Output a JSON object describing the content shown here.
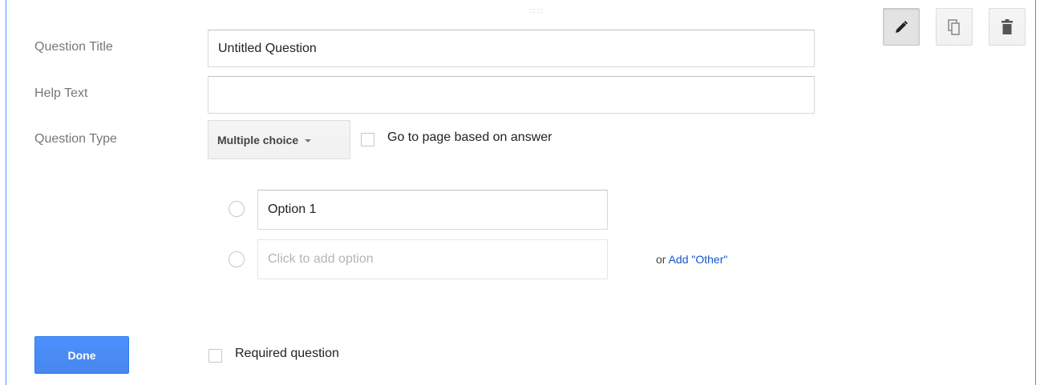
{
  "form": {
    "question_title_label": "Question Title",
    "question_title_value": "Untitled Question",
    "help_text_label": "Help Text",
    "help_text_value": "",
    "question_type_label": "Question Type",
    "question_type_value": "Multiple choice",
    "go_to_page_label": "Go to page based on answer",
    "go_to_page_checked": false
  },
  "options": {
    "option1_value": "Option 1",
    "add_option_placeholder": "Click to add option",
    "or_label": "or",
    "add_other_link": "Add \"Other\""
  },
  "footer": {
    "done_label": "Done",
    "required_label": "Required question",
    "required_checked": false
  },
  "toolbar": {
    "edit_icon": "pencil-icon",
    "duplicate_icon": "duplicate-icon",
    "delete_icon": "trash-icon"
  },
  "colors": {
    "accent": "#4d90fe",
    "link": "#1155cc",
    "label": "#777777"
  }
}
